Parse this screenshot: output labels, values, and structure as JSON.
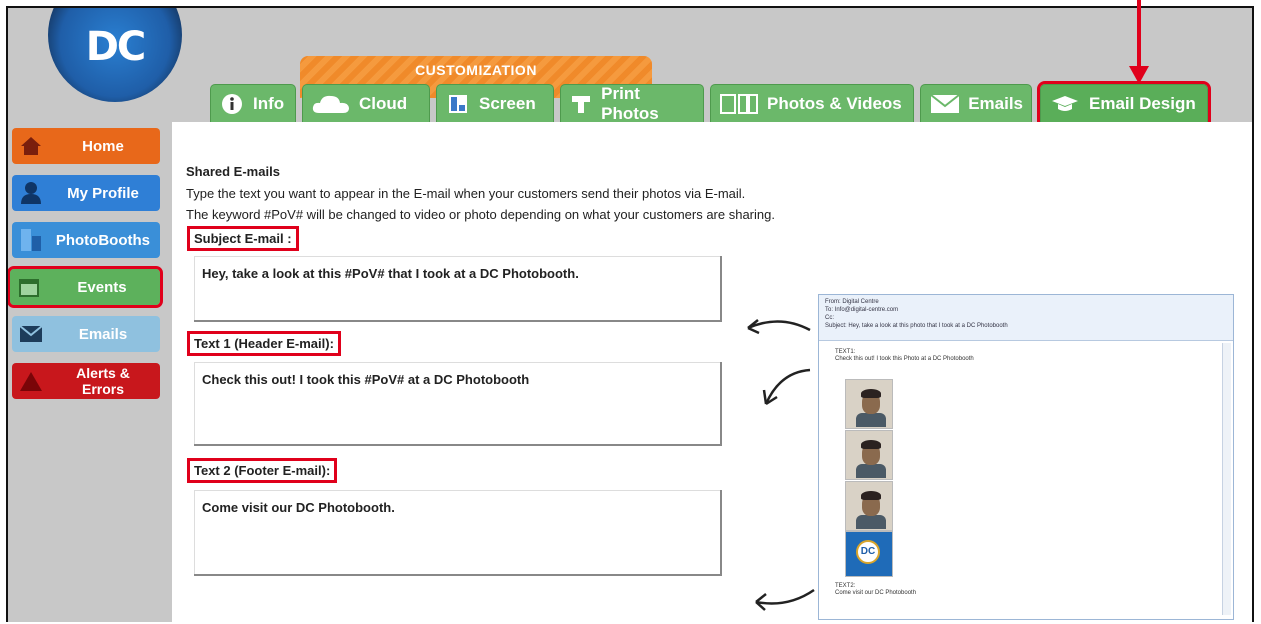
{
  "logo": {
    "text": "DC"
  },
  "customization_label": "CUSTOMIZATION",
  "tabs": [
    {
      "label": "Info",
      "icon": "info-icon"
    },
    {
      "label": "Cloud",
      "icon": "cloud-icon"
    },
    {
      "label": "Screen",
      "icon": "screen-icon"
    },
    {
      "label": "Print Photos",
      "icon": "printer-icon"
    },
    {
      "label": "Photos & Videos",
      "icon": "photos-videos-icon"
    },
    {
      "label": "Emails",
      "icon": "envelope-icon"
    },
    {
      "label": "Email Design",
      "icon": "graduation-cap-icon"
    }
  ],
  "sidebar": {
    "items": [
      {
        "label": "Home",
        "icon": "home-icon",
        "color": "#e8681a"
      },
      {
        "label": "My Profile",
        "icon": "user-icon",
        "color": "#2f7fd6"
      },
      {
        "label": "PhotoBooths",
        "icon": "photobooth-icon",
        "color": "#3a8fd8"
      },
      {
        "label": "Events",
        "icon": "calendar-icon",
        "color": "#5db15c"
      },
      {
        "label": "Emails",
        "icon": "envelope-icon",
        "color": "#8fc1df"
      },
      {
        "label": "Alerts & Errors",
        "icon": "warning-icon",
        "color": "#c8171c"
      }
    ]
  },
  "main": {
    "heading": "Shared E-mails",
    "intro1": "Type the text you want to appear in the E-mail when your customers send their photos via E-mail.",
    "intro2": "The keyword #PoV# will be changed to video or photo depending on what your customers are sharing.",
    "subject_label": "Subject E-mail :",
    "subject_value": "Hey, take a look at this #PoV# that I took at a DC Photobooth.",
    "header_label": "Text 1 (Header E-mail):",
    "header_value": "Check this out!  I took this #PoV# at a DC Photobooth",
    "footer_label": "Text 2 (Footer E-mail):",
    "footer_value": "Come visit our DC Photobooth."
  },
  "preview": {
    "from": "From:  Digital Centre",
    "to": "To:    Info@digital-centre.com",
    "cc": "Cc:",
    "subject": "Subject:  Hey, take a look at this photo that I took at a DC Photobooth",
    "text1_label": "TEXT1:",
    "text1": "Check this out! I took this Photo at a DC Photobooth",
    "dc_logo": "DC",
    "text2_label": "TEXT2:",
    "text2": "Come visit our DC Photobooth"
  },
  "colors": {
    "highlight": "#e0001b",
    "tab_green": "#6bb86a",
    "banner_orange": "#f08a2a"
  }
}
